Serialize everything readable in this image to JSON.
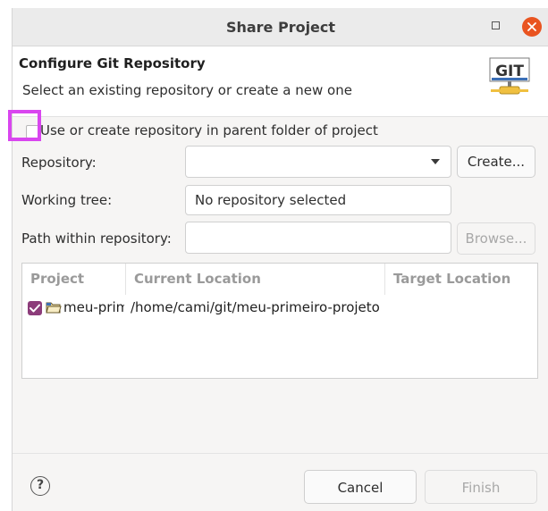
{
  "window": {
    "title": "Share Project"
  },
  "header": {
    "title": "Configure Git Repository",
    "subtitle": "Select an existing repository or create a new one",
    "logo_text": "GIT"
  },
  "options": {
    "parent_folder_label": "Use or create repository in parent folder of project",
    "parent_folder_checked": false
  },
  "form": {
    "repository_label": "Repository:",
    "repository_value": "",
    "create_button": "Create...",
    "working_tree_label": "Working tree:",
    "working_tree_value": "No repository selected",
    "path_label": "Path within repository:",
    "path_value": "",
    "browse_button": "Browse..."
  },
  "table": {
    "columns": [
      "Project",
      "Current Location",
      "Target Location"
    ],
    "rows": [
      {
        "checked": true,
        "project": "meu-primeiro-projeto",
        "current_location": "/home/cami/git/meu-primeiro-projeto",
        "target_location": ""
      }
    ]
  },
  "footer": {
    "help_glyph": "?",
    "cancel_button": "Cancel",
    "finish_button": "Finish"
  },
  "colors": {
    "accent": "#8c3c7a",
    "close": "#e95420",
    "highlight": "#d946ef"
  }
}
